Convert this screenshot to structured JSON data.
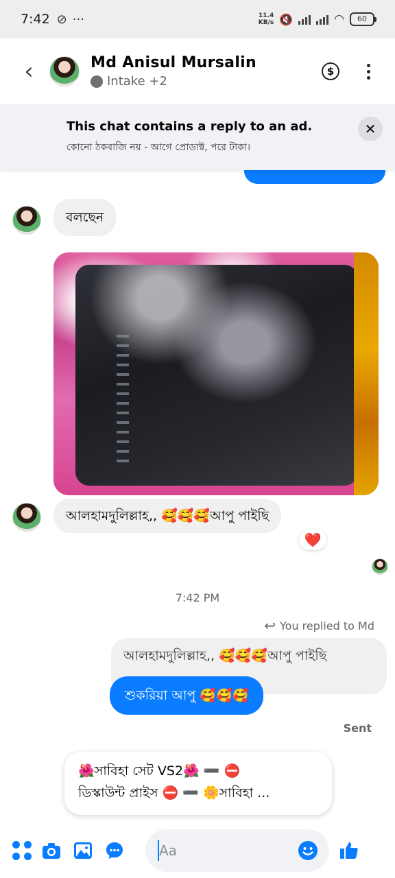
{
  "status_bar": {
    "time": "7:42",
    "speed_top": "11.4",
    "speed_bottom": "KB/s",
    "battery": "60"
  },
  "header": {
    "name": "Md Anisul Mursalin",
    "subtitle": "Intake +2"
  },
  "ad_banner": {
    "title": "This chat contains a reply to an ad.",
    "subtitle": "কোনো ঠকবাজি নয় - আগে প্রোডাক্ট, পরে টাকা।"
  },
  "messages": {
    "first_incoming": "বলছেন",
    "second_incoming": "আলহামদুলিল্লাহ,, 🥰🥰🥰আপু পাইছি",
    "heart_reaction": "❤️",
    "timestamp": "7:42 PM",
    "replied_label": "You replied to Md",
    "quoted_text": "আলহামদুলিল্লাহ,, 🥰🥰🥰আপু পাইছি",
    "outgoing": "শুকরিয়া আপু 🥰🥰🥰",
    "status": "Sent"
  },
  "suggestion": {
    "line1": "🌺সাবিহা সেট VS2🌺 ➖ ⛔",
    "line2": "ডিস্কাউন্ট প্রাইস ⛔ ➖ 🌼সাবিহা ..."
  },
  "composer": {
    "placeholder": "Aa"
  },
  "colors": {
    "accent": "#0a7cff",
    "bubble_incoming": "#f0f0f0"
  }
}
